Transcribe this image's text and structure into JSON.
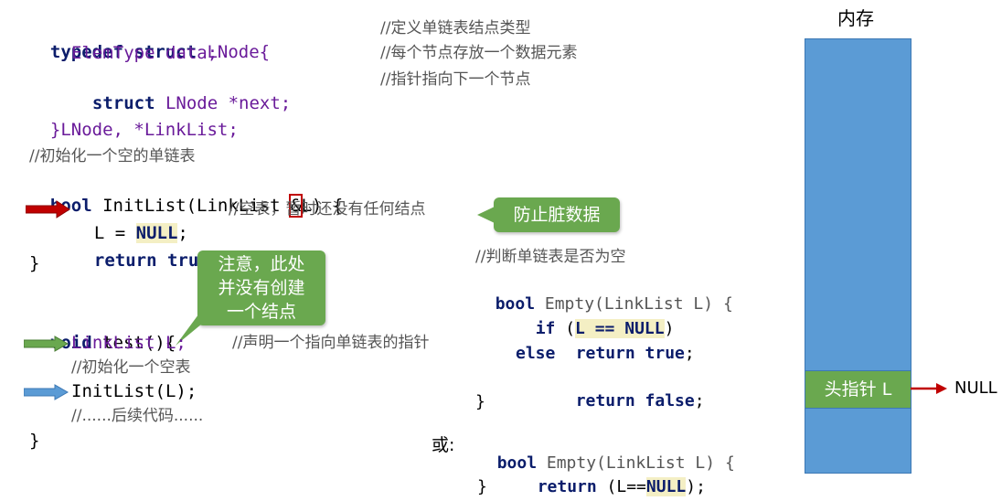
{
  "code_top": {
    "line1_kw": "typedef struct ",
    "line1_name": "LNode{",
    "line1_comment": "//定义单链表结点类型",
    "line2": "ElemType data;",
    "line2_comment": "//每个节点存放一个数据元素",
    "line3_kw": "struct ",
    "line3_rest": "LNode *next;",
    "line3_comment": "//指针指向下一个节点",
    "line4": "}LNode, *LinkList;"
  },
  "init_func": {
    "comment": "//初始化一个空的单链表",
    "sig_kw": "bool ",
    "sig_name": "InitList(LinkList ",
    "sig_amp": "&",
    "sig_end": "L) {",
    "body1_pre": "L = ",
    "body1_null": "NULL",
    "body1_post": ";",
    "body1_comment": "//空表，暂时还没有任何结点",
    "body2_kw": "return true",
    "body2_end": ";",
    "close": "}"
  },
  "test_func": {
    "sig_kw": "void ",
    "sig_rest": "test(){",
    "line1": "LinkList L;",
    "line1_comment": "//声明一个指向单链表的指针",
    "line2_comment": "//初始化一个空表",
    "line3": "InitList(L);",
    "line4": "//......后续代码......",
    "close": "}"
  },
  "empty_func1": {
    "comment": "//判断单链表是否为空",
    "sig_kw": "bool ",
    "sig_rest": "Empty(LinkList L) {",
    "if_kw": "if ",
    "if_open": "(",
    "if_cond": "L == NULL",
    "if_close": ")",
    "ret_true_kw": "return true",
    "ret_true_end": ";",
    "else_kw": "else",
    "ret_false_kw": "return false",
    "ret_false_end": ";",
    "close": "}"
  },
  "empty_func2": {
    "or_label": "或:",
    "sig_kw": "bool ",
    "sig_rest": "Empty(LinkList L) {",
    "ret_kw": "return ",
    "ret_open": "(L==",
    "ret_null": "NULL",
    "ret_close": ");",
    "close": "}"
  },
  "bubbles": {
    "dirty": "防止脏数据",
    "note_line1": "注意，此处",
    "note_line2": "并没有创建",
    "note_line3": "一个结点"
  },
  "memory": {
    "title": "内存",
    "head_pointer": "头指针 L",
    "null_label": "NULL"
  },
  "colors": {
    "red_arrow": "#c00000",
    "green_arrow": "#6aa84f",
    "blue_arrow": "#5b9bd5",
    "memory_blue": "#5b9bd5",
    "bubble_green": "#6aa84f"
  }
}
